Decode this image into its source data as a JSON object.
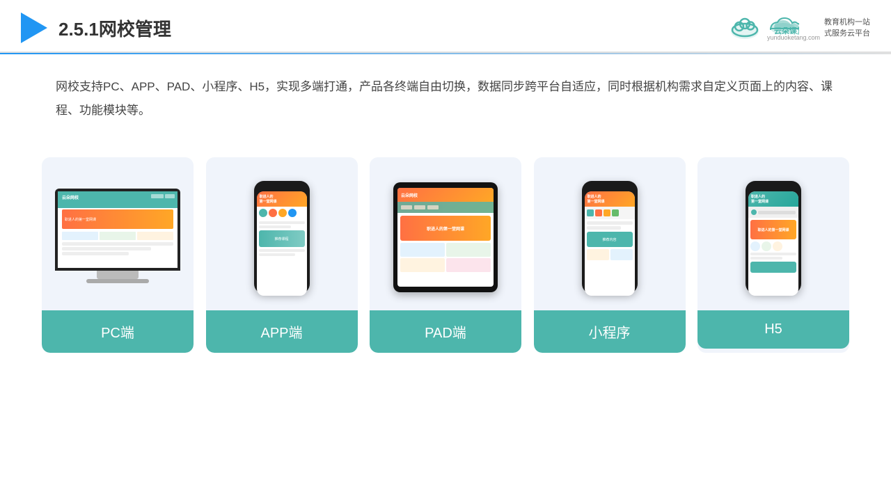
{
  "header": {
    "title": "2.5.1网校管理",
    "logo_name": "云朵课堂",
    "logo_url": "yunduoketang.com",
    "logo_slogan": "教育机构一站\n式服务云平台"
  },
  "description": "网校支持PC、APP、PAD、小程序、H5，实现多端打通，产品各终端自由切换，数据同步跨平台自适应，同时根据机构需求自定义页面上的内容、课程、功能模块等。",
  "cards": [
    {
      "id": "pc",
      "label": "PC端",
      "type": "pc"
    },
    {
      "id": "app",
      "label": "APP端",
      "type": "phone"
    },
    {
      "id": "pad",
      "label": "PAD端",
      "type": "pad"
    },
    {
      "id": "miniprogram",
      "label": "小程序",
      "type": "phone"
    },
    {
      "id": "h5",
      "label": "H5",
      "type": "phone"
    }
  ],
  "colors": {
    "teal": "#4db6ac",
    "blue": "#2196F3",
    "accent": "#ff7043",
    "accent2": "#ffa726"
  }
}
